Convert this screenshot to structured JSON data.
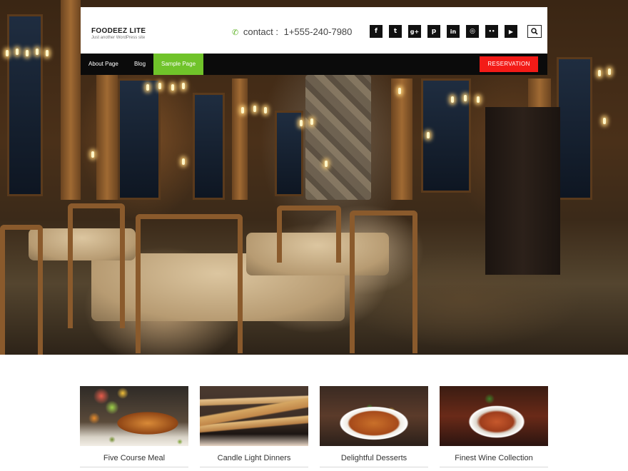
{
  "site": {
    "title": "FOODEEZ LITE",
    "tagline": "Just another WordPress site"
  },
  "contact": {
    "label": "contact :",
    "phone": "1+555-240-7980",
    "icon": "phone-icon",
    "icon_color": "#5fb328"
  },
  "social": [
    {
      "name": "facebook-icon",
      "glyph": "f"
    },
    {
      "name": "twitter-icon",
      "glyph": "t"
    },
    {
      "name": "google-plus-icon",
      "glyph": "g+"
    },
    {
      "name": "pinterest-icon",
      "glyph": "p"
    },
    {
      "name": "linkedin-icon",
      "glyph": "in"
    },
    {
      "name": "dribbble-icon",
      "glyph": "◎"
    },
    {
      "name": "flickr-icon",
      "glyph": "••"
    },
    {
      "name": "youtube-icon",
      "glyph": "▶"
    }
  ],
  "nav": {
    "items": [
      {
        "label": "About Page",
        "active": false
      },
      {
        "label": "Blog",
        "active": false
      },
      {
        "label": "Sample Page",
        "active": true
      }
    ],
    "reservation_label": "RESERVATION",
    "active_color": "#70c32a",
    "reservation_color": "#f31b17"
  },
  "features": [
    {
      "caption": "Five Course Meal"
    },
    {
      "caption": "Candle Light Dinners"
    },
    {
      "caption": "Delightful Desserts"
    },
    {
      "caption": "Finest Wine Collection"
    }
  ]
}
